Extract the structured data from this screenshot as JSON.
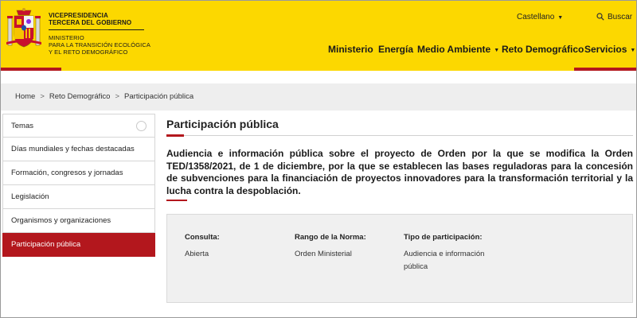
{
  "header": {
    "gov_lines": [
      "VICEPRESIDENCIA",
      "TERCERA DEL GOBIERNO"
    ],
    "ministry_lines": [
      "MINISTERIO",
      "PARA LA TRANSICIÓN ECOLÓGICA",
      "Y EL RETO DEMOGRÁFICO"
    ],
    "language": "Castellano",
    "search_label": "Buscar",
    "nav": [
      "Ministerio",
      "Energía",
      "Medio Ambiente",
      "Reto Demográfico",
      "Servicios"
    ],
    "colors": {
      "yellow": "#fcd800",
      "red": "#b3171d"
    }
  },
  "breadcrumb": [
    "Home",
    "Reto Demográfico",
    "Participación pública"
  ],
  "sidebar": {
    "items": [
      "Temas",
      "Días mundiales y fechas destacadas",
      "Formación, congresos y jornadas",
      "Legislación",
      "Organismos y organizaciones",
      "Participación pública"
    ],
    "active": "Participación pública"
  },
  "main": {
    "title": "Participación pública",
    "headline": "Audiencia e información pública sobre el proyecto de Orden por la que se modifica la Orden TED/1358/2021, de 1 de diciembre, por la que se establecen las bases reguladoras para la concesión de subvenciones para la financiación de proyectos innovadores para la transformación territorial y la lucha contra la despoblación.",
    "info": {
      "consulta_label": "Consulta:",
      "consulta_value": "Abierta",
      "rango_label": "Rango de la Norma:",
      "rango_value": "Orden Ministerial",
      "tipo_label": "Tipo de participación:",
      "tipo_value": "Audiencia e información pública"
    }
  }
}
